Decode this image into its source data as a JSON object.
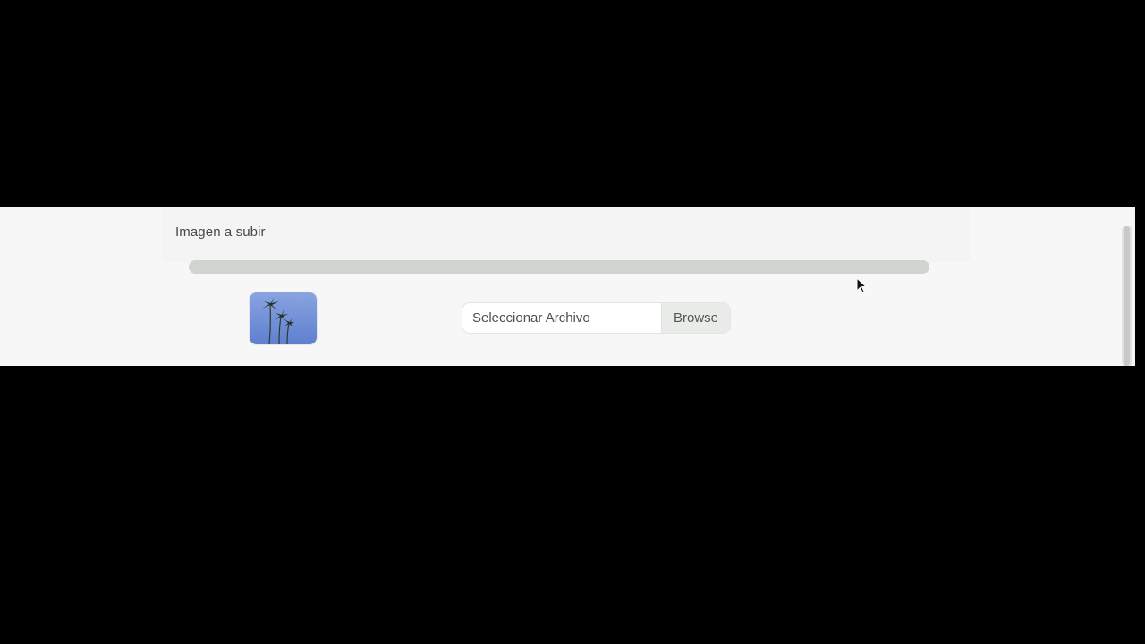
{
  "form": {
    "label": "Imagen a subir",
    "progress_fraction": 1.0,
    "thumbnail_icon": "palm-trees-image",
    "file_input": {
      "placeholder": "Seleccionar Archivo",
      "browse_label": "Browse"
    }
  },
  "colors": {
    "page_background": "#f6f7f6",
    "progress_track": "#dfe2df",
    "browse_button_bg": "#e9ebe9",
    "sky_blue": "#6f8fd6"
  }
}
